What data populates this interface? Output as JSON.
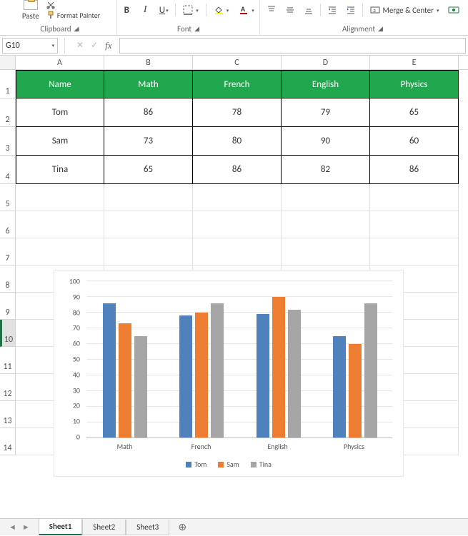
{
  "ribbon": {
    "paste_label": "Paste",
    "format_painter": "Format Painter",
    "clipboard_label": "Clipboard",
    "font_label": "Font",
    "alignment_label": "Alignment",
    "bold": "B",
    "italic": "I",
    "underline": "U",
    "merge_center": "Merge & Center"
  },
  "formula_bar": {
    "name_box": "G10",
    "fx": "fx",
    "value": ""
  },
  "columns": [
    "A",
    "B",
    "C",
    "D",
    "E"
  ],
  "table": {
    "headers": [
      "Name",
      "Math",
      "French",
      "English",
      "Physics"
    ],
    "rows": [
      {
        "name": "Tom",
        "values": [
          86,
          78,
          79,
          65
        ]
      },
      {
        "name": "Sam",
        "values": [
          73,
          80,
          90,
          60
        ]
      },
      {
        "name": "Tina",
        "values": [
          65,
          86,
          82,
          86
        ]
      }
    ]
  },
  "blank_rows": [
    5,
    6,
    7,
    8,
    9,
    10,
    11,
    12,
    13,
    14
  ],
  "selected_row": 10,
  "chart_data": {
    "type": "bar",
    "categories": [
      "Math",
      "French",
      "English",
      "Physics"
    ],
    "series": [
      {
        "name": "Tom",
        "color": "#4f81bd",
        "values": [
          86,
          78,
          79,
          65
        ]
      },
      {
        "name": "Sam",
        "color": "#ed7d31",
        "values": [
          73,
          80,
          90,
          60
        ]
      },
      {
        "name": "Tina",
        "color": "#a5a5a5",
        "values": [
          65,
          86,
          82,
          86
        ]
      }
    ],
    "ylim": [
      0,
      100
    ],
    "yticks": [
      0,
      10,
      20,
      30,
      40,
      50,
      60,
      70,
      80,
      90,
      100
    ]
  },
  "sheets": {
    "tabs": [
      "Sheet1",
      "Sheet2",
      "Sheet3"
    ],
    "active": 0
  }
}
